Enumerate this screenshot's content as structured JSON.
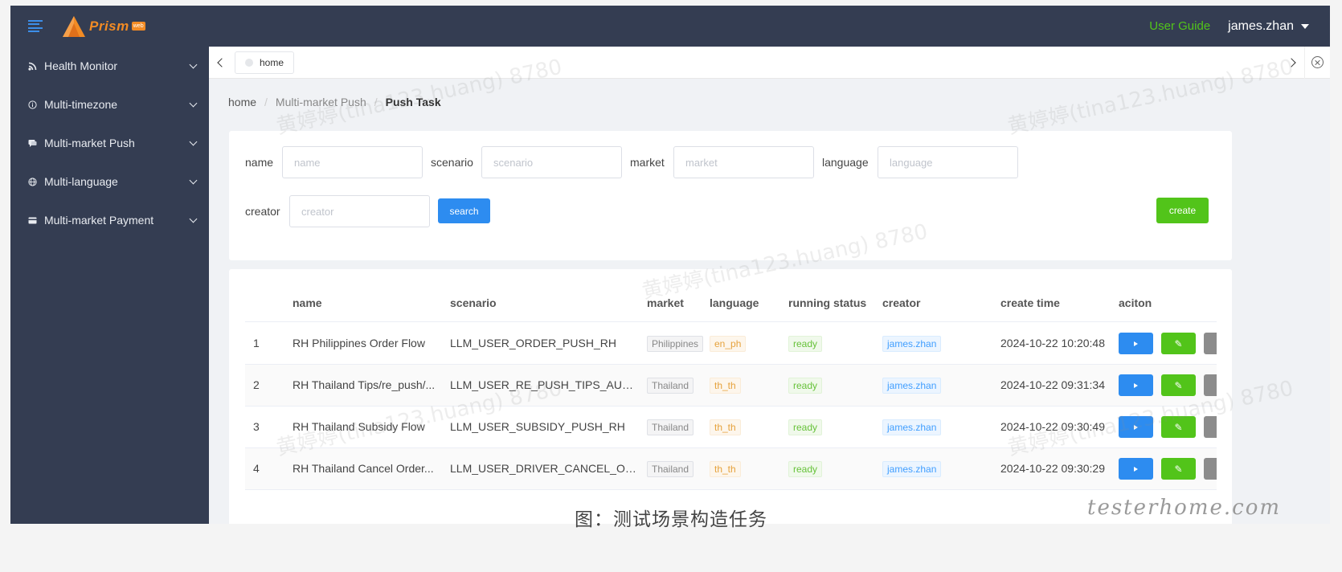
{
  "header": {
    "brand": "Prism",
    "brand_badge": "web",
    "user_guide": "User Guide",
    "username": "james.zhan"
  },
  "sidebar": {
    "items": [
      {
        "label": "Health Monitor",
        "icon": "rss-icon"
      },
      {
        "label": "Multi-timezone",
        "icon": "info-circle-icon"
      },
      {
        "label": "Multi-market Push",
        "icon": "chat-bubble-icon"
      },
      {
        "label": "Multi-language",
        "icon": "globe-icon"
      },
      {
        "label": "Multi-market Payment",
        "icon": "credit-card-icon"
      }
    ]
  },
  "tabs": [
    {
      "label": "home"
    }
  ],
  "breadcrumb": {
    "items": [
      "home",
      "Multi-market Push",
      "Push Task"
    ]
  },
  "search_form": {
    "name_label": "name",
    "name_placeholder": "name",
    "scenario_label": "scenario",
    "scenario_placeholder": "scenario",
    "market_label": "market",
    "market_placeholder": "market",
    "language_label": "language",
    "language_placeholder": "language",
    "creator_label": "creator",
    "creator_placeholder": "creator",
    "search_button": "search",
    "create_button": "create"
  },
  "table": {
    "columns": [
      "name",
      "scenario",
      "market",
      "language",
      "running status",
      "creator",
      "create time",
      "aciton"
    ],
    "rows": [
      {
        "index": "1",
        "name": "RH Philippines Order Flow",
        "scenario": "LLM_USER_ORDER_PUSH_RH",
        "market": "Philippines",
        "language": "en_ph",
        "status": "ready",
        "creator": "james.zhan",
        "create_time": "2024-10-22 10:20:48"
      },
      {
        "index": "2",
        "name": "RH Thailand Tips/re_push/...",
        "scenario": "LLM_USER_RE_PUSH_TIPS_AUTO...",
        "market": "Thailand",
        "language": "th_th",
        "status": "ready",
        "creator": "james.zhan",
        "create_time": "2024-10-22 09:31:34"
      },
      {
        "index": "3",
        "name": "RH Thailand Subsidy Flow",
        "scenario": "LLM_USER_SUBSIDY_PUSH_RH",
        "market": "Thailand",
        "language": "th_th",
        "status": "ready",
        "creator": "james.zhan",
        "create_time": "2024-10-22 09:30:49"
      },
      {
        "index": "4",
        "name": "RH Thailand Cancel Order...",
        "scenario": "LLM_USER_DRIVER_CANCEL_OR...",
        "market": "Thailand",
        "language": "th_th",
        "status": "ready",
        "creator": "james.zhan",
        "create_time": "2024-10-22 09:30:29"
      }
    ]
  },
  "caption": "图：测试场景构造任务",
  "site_mark": "testerhome.com",
  "watermark": "黄婷婷(tina123.huang) 8780",
  "colors": {
    "sidebar_bg": "#343d52",
    "primary_blue": "#2d8cf0",
    "success_green": "#52c41a",
    "brand_orange": "#f28b24"
  }
}
